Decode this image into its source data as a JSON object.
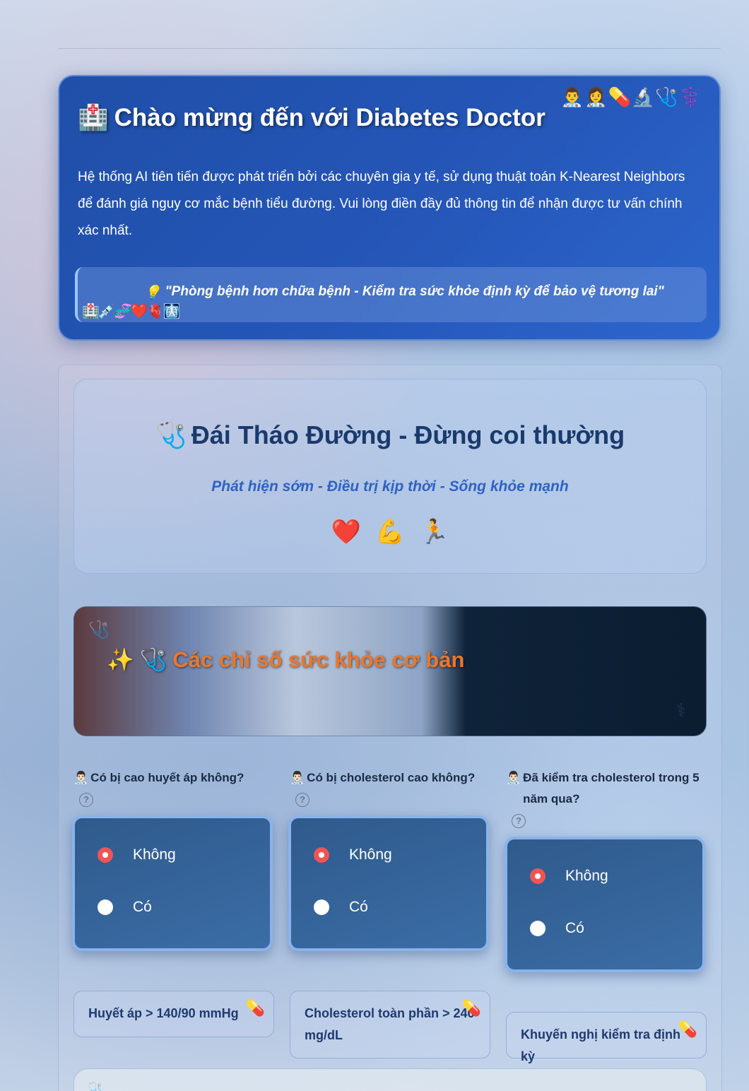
{
  "hero": {
    "emojis": "👨‍⚕️👩‍⚕️💊🔬🩺⚕️",
    "title_icon": "🏥",
    "title": "Chào mừng đến với Diabetes Doctor",
    "description": "Hệ thống AI tiên tiến được phát triển bởi các chuyên gia y tế, sử dụng thuật toán K-Nearest Neighbors để đánh giá nguy cơ mắc bệnh tiểu đường. Vui lòng điền đầy đủ thông tin để nhận được tư vấn chính xác nhất.",
    "quote_icon": "💡",
    "quote": "\"Phòng bệnh hơn chữa bệnh - Kiểm tra sức khỏe định kỳ để bảo vệ tương lai\"",
    "quote_emojis": "🏥💉🧬❤️🫀🩻"
  },
  "banner": {
    "icon": "🩺",
    "title": "Đái Tháo Đường - Đừng coi thường",
    "subtitle": "Phát hiện sớm - Điều trị kịp thời - Sống khỏe mạnh",
    "icons": [
      "❤️",
      "💪",
      "🏃"
    ]
  },
  "section": {
    "sparkle": "✨",
    "icon": "🩺",
    "title": "Các chỉ số sức khỏe cơ bản",
    "ghost_icon": "🩺",
    "ghost_icon2": "⚕"
  },
  "questions": [
    {
      "icon": "👨🏻‍⚕️",
      "label": "Có bị cao huyết áp không?",
      "options": [
        "Không",
        "Có"
      ],
      "selected": "Không",
      "hint": "Huyết áp > 140/90 mmHg"
    },
    {
      "icon": "👨🏻‍⚕️",
      "label": "Có bị cholesterol cao không?",
      "options": [
        "Không",
        "Có"
      ],
      "selected": "Không",
      "hint": "Cholesterol toàn phần > 240 mg/dL"
    },
    {
      "icon": "👨🏻‍⚕️",
      "label": "Đã kiểm tra cholesterol trong 5 năm qua?",
      "options": [
        "Không",
        "Có"
      ],
      "selected": "Không",
      "hint": "Khuyến nghị kiểm tra định kỳ"
    }
  ],
  "hint_icon": "💊",
  "help_glyph": "?"
}
